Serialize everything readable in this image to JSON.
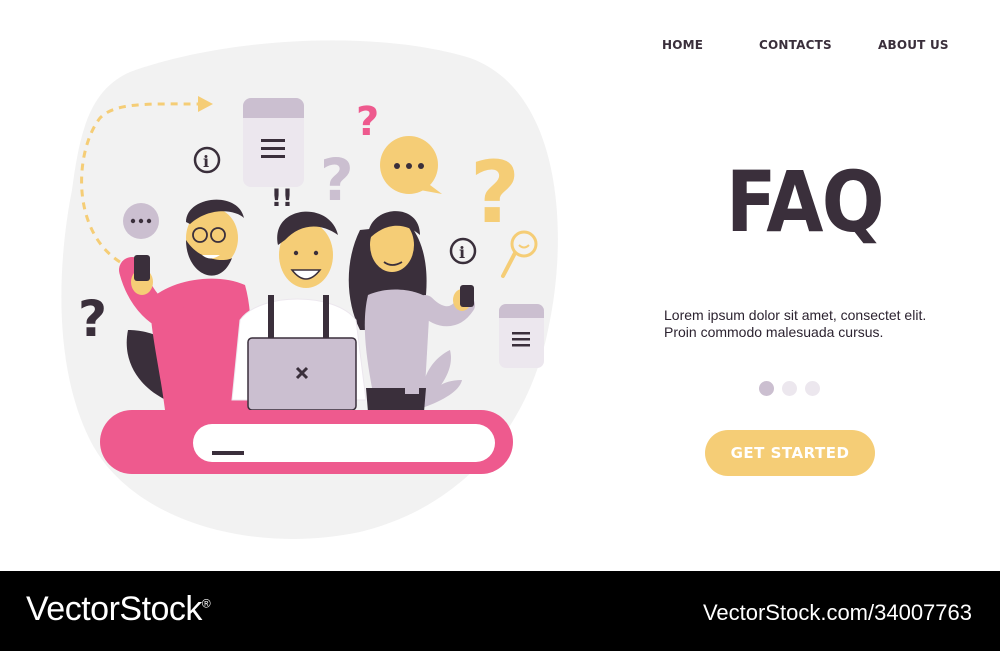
{
  "nav": {
    "home": "HOME",
    "contacts": "CONTACTS",
    "about": "ABOUT US"
  },
  "hero": {
    "title": "FAQ",
    "description": "Lorem ipsum dolor sit amet, consectet elit. Proin commodo malesuada cursus.",
    "cta_label": "GET STARTED"
  },
  "carousel": {
    "total": 3,
    "active_index": 0
  },
  "illustration": {
    "exclamation": "!!",
    "icons": [
      "question-mark-icon",
      "info-icon",
      "chat-bubble-icon",
      "document-icon",
      "magnifier-icon",
      "phone-icon",
      "laptop-icon",
      "search-bar-icon"
    ]
  },
  "colors": {
    "dark": "#3a2f3b",
    "pink": "#ee5a8e",
    "lilac": "#cbbfd0",
    "yellow": "#f5cd76",
    "light_gray": "#f2f2f2"
  },
  "watermark": {
    "brand": "VectorStock",
    "registered": "®",
    "url": "VectorStock.com/34007763"
  }
}
